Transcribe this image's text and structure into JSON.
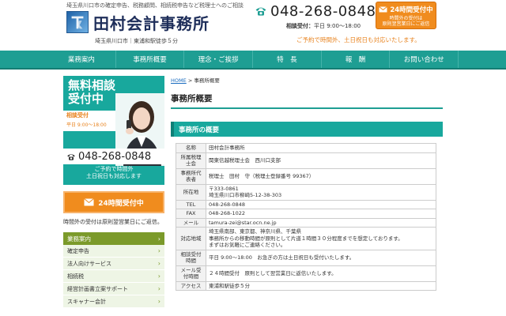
{
  "header": {
    "tagline": "埼玉県川口市の確定申告、税務顧問、相続税申告など税理士へのご相談",
    "office_name": "田村会計事務所",
    "address_line": "埼玉県川口市｜東浦和駅徒歩５分",
    "phone": "048-268-0848",
    "hours_label": "相談受付：",
    "hours_value": "平日 9:00～18:00",
    "open_note": "ご予約で時間外、土日祝日も対応いたします。",
    "badge_label": "24時間受付中",
    "badge_sub1": "時間外の受付は",
    "badge_sub2": "原則翌営業日にご返信"
  },
  "nav": {
    "items": [
      "業務案内",
      "事務所概要",
      "理念・ご挨拶",
      "特　長",
      "報　酬",
      "お問い合わせ"
    ]
  },
  "sidebar": {
    "consult_title_1": "無料相談",
    "consult_title_2": "受付中",
    "consult_info_1": "相談受付",
    "consult_info_2": "平日 9:00～18:00",
    "consult_phone": "048-268-0848",
    "consult_note_1": "ご予約で時間外",
    "consult_note_2": "土日祝日も対応します",
    "button24": "24時間受付中",
    "reply_note": "時間外の受付は原則翌営業日にご返信。",
    "menu_head": "業務案内",
    "menu_items": [
      "確定申告",
      "法人向けサービス",
      "相続税",
      "経営計画書立案サポート",
      "スキャナー会計"
    ]
  },
  "main": {
    "breadcrumb_home": "HOME",
    "breadcrumb_sep": ">",
    "breadcrumb_current": "事務所概要",
    "page_title": "事務所概要",
    "section_heading": "事務所の概要",
    "rows": [
      {
        "k": "名称",
        "v": "田村会計事務所"
      },
      {
        "k": "所属税理士会",
        "v": "関東信越税理士会　西川口支部"
      },
      {
        "k": "事務所代表者",
        "v": "税理士　田村　守（税理士登録番号 99367）"
      },
      {
        "k": "所在地",
        "v": "〒333-0861",
        "v2": "埼玉県川口市柳崎5-12-38-303"
      },
      {
        "k": "TEL",
        "v": "048-268-0848"
      },
      {
        "k": "FAX",
        "v": "048-268-1022"
      },
      {
        "k": "メール",
        "v": "tamura-zei@star.ocn.ne.jp"
      },
      {
        "k": "対応地域",
        "v": "埼玉県南部、東京都、神奈川県、千葉県",
        "v2": "事務所からの移動時間が原則として片道１時間３０分程度までを想定しております。",
        "v3": "まずはお気軽にご連絡ください。"
      },
      {
        "k": "相談受付時間",
        "v": "平日 9:00～18:00　お急ぎの方は土日祝日も受付いたします。"
      },
      {
        "k": "メール受付時間",
        "v": "２４時間受付　原則として翌営業日に返信いたします。"
      },
      {
        "k": "アクセス",
        "v": "東浦和駅徒歩５分"
      }
    ]
  },
  "colors": {
    "teal": "#1e9e93",
    "orange": "#f08c1e",
    "green": "#7b9a2a",
    "navy": "#1e2e5a"
  },
  "icons": [
    "phone-icon",
    "mail-icon",
    "chevron-right-icon",
    "logo-icon"
  ]
}
